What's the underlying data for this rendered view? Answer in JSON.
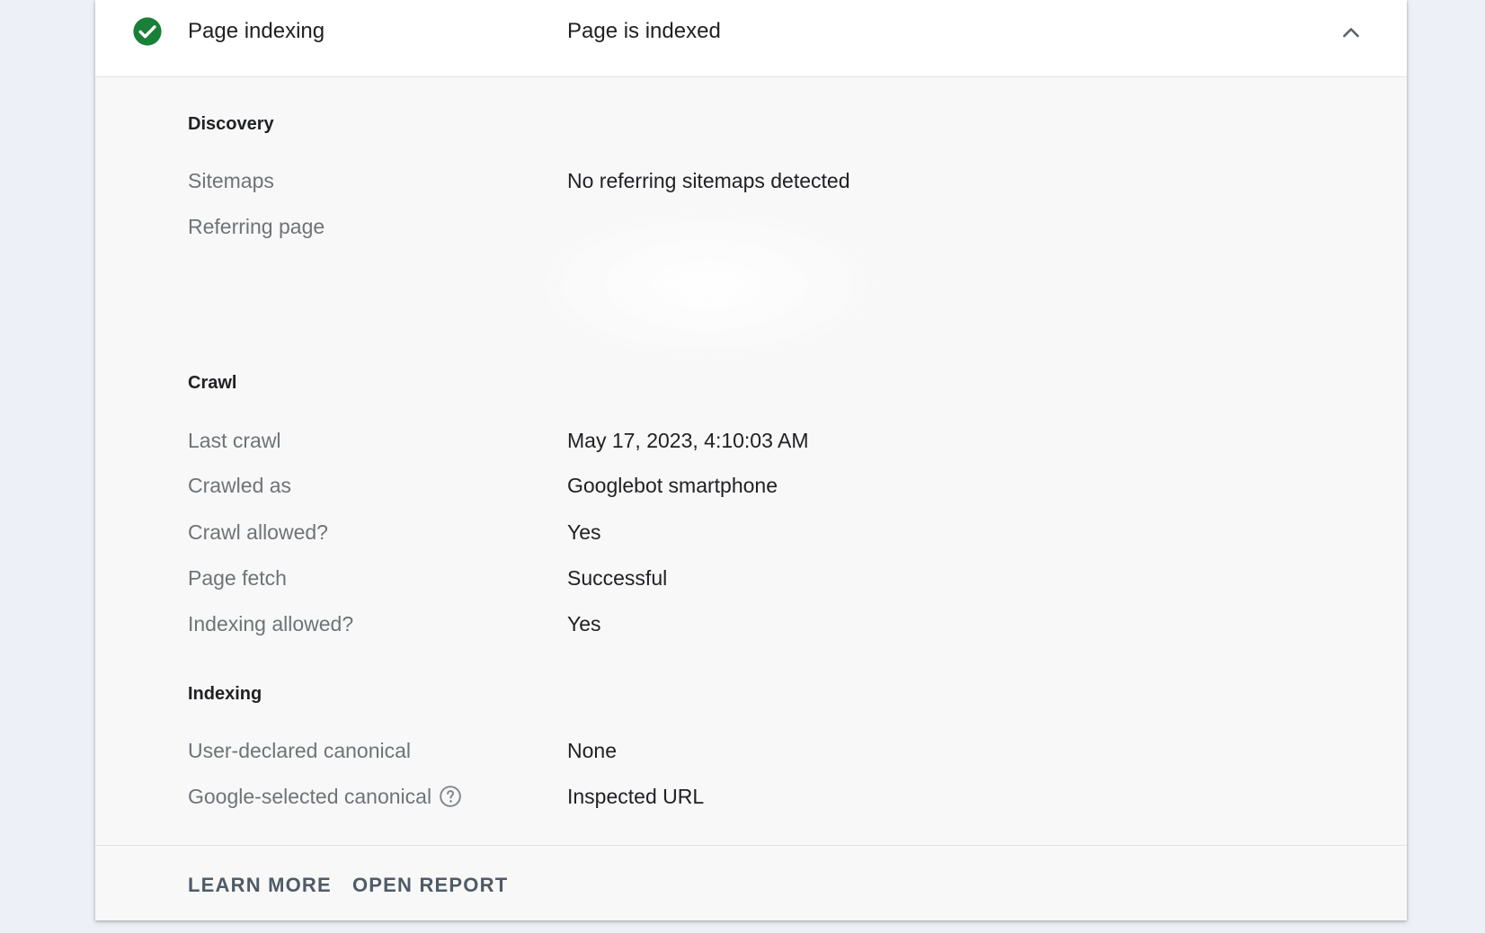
{
  "header": {
    "title": "Page indexing",
    "status": "Page is indexed",
    "status_color": "#188038",
    "status_icon": "check-circle-icon",
    "toggle_icon": "chevron-up-icon"
  },
  "sections": {
    "discovery": {
      "title": "Discovery",
      "sitemaps_label": "Sitemaps",
      "sitemaps_value": "No referring sitemaps detected",
      "referring_page_label": "Referring page"
    },
    "crawl": {
      "title": "Crawl",
      "last_crawl_label": "Last crawl",
      "last_crawl_value": "May 17, 2023, 4:10:03 AM",
      "crawled_as_label": "Crawled as",
      "crawled_as_value": "Googlebot smartphone",
      "crawl_allowed_label": "Crawl allowed?",
      "crawl_allowed_value": "Yes",
      "page_fetch_label": "Page fetch",
      "page_fetch_value": "Successful",
      "indexing_allowed_label": "Indexing allowed?",
      "indexing_allowed_value": "Yes"
    },
    "indexing": {
      "title": "Indexing",
      "user_canonical_label": "User-declared canonical",
      "user_canonical_value": "None",
      "google_canonical_label": "Google-selected canonical",
      "google_canonical_value": "Inspected URL",
      "help_icon": "help-circle-icon"
    }
  },
  "footer": {
    "learn_more": "LEARN MORE",
    "open_report": "OPEN REPORT"
  }
}
